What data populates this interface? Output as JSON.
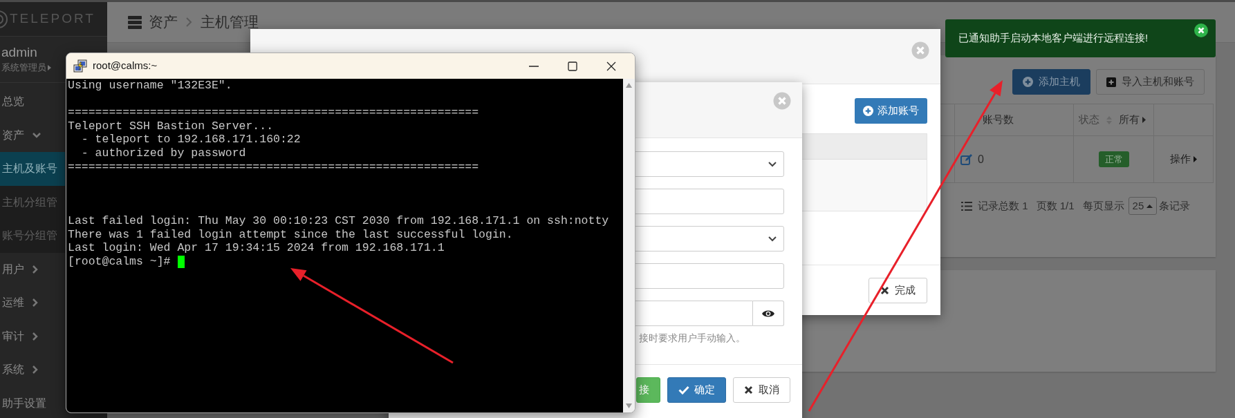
{
  "sidebar": {
    "logo": "TELEPORT",
    "user": {
      "name": "admin",
      "role": "系统管理员"
    },
    "items": [
      {
        "label": "总览",
        "kind": "link",
        "selected": false
      },
      {
        "label": "资产",
        "kind": "group",
        "expanded": true,
        "selected": false,
        "children": [
          {
            "label": "主机及账号",
            "selected": true
          },
          {
            "label": "主机分组管",
            "selected": false
          },
          {
            "label": "账号分组管",
            "selected": false
          }
        ]
      },
      {
        "label": "用户",
        "kind": "group",
        "expanded": false,
        "selected": false
      },
      {
        "label": "运维",
        "kind": "group",
        "expanded": false,
        "selected": false
      },
      {
        "label": "审计",
        "kind": "group",
        "expanded": false,
        "selected": false
      },
      {
        "label": "系统",
        "kind": "group",
        "expanded": false,
        "selected": false
      },
      {
        "label": "助手设置",
        "kind": "link",
        "selected": false
      }
    ]
  },
  "breadcrumb": [
    "资产",
    "主机管理"
  ],
  "toolbar_buttons": [
    {
      "label": "添加主机",
      "kind": "primary"
    },
    {
      "label": "导入主机和账号",
      "kind": "default"
    }
  ],
  "table": {
    "columns": [
      "账号数",
      "状态"
    ],
    "status_filter": "所有",
    "rows": [
      {
        "accounts": "0",
        "status": "正常",
        "action": "操作"
      }
    ]
  },
  "pagination": {
    "total": "记录总数 1",
    "pages": "页数 1/1",
    "per_page_label": "每页显示",
    "per_page": "25",
    "suffix": "条记录"
  },
  "notification": {
    "text": "已通知助手启动本地客户端进行远程连接!"
  },
  "account_dialog": {
    "add_button": "添加账号",
    "done_button": "完成"
  },
  "edit_dialog": {
    "fields": [
      {
        "kind": "select"
      },
      {
        "kind": "input"
      },
      {
        "kind": "select"
      },
      {
        "kind": "input"
      },
      {
        "kind": "password"
      }
    ],
    "hint": "接时要求用户手动输入。",
    "buttons": [
      {
        "label": "接",
        "kind": "success"
      },
      {
        "label": "确定",
        "kind": "primary"
      },
      {
        "label": "取消",
        "kind": "default"
      }
    ]
  },
  "terminal": {
    "title": "root@calms:~",
    "blocks": [
      [
        "Using username \"132E3E\"."
      ],
      [
        "============================================================",
        "Teleport SSH Bastion Server...",
        "  - teleport to 192.168.171.160:22",
        "  - authorized by password",
        "============================================================"
      ],
      [
        "Last failed login: Thu May 30 00:10:23 CST 2030 from 192.168.171.1 on ssh:notty",
        "There was 1 failed login attempt since the last successful login.",
        "Last login: Wed Apr 17 19:34:15 2024 from 192.168.171.1"
      ]
    ],
    "prompt": "[root@calms ~]#"
  }
}
